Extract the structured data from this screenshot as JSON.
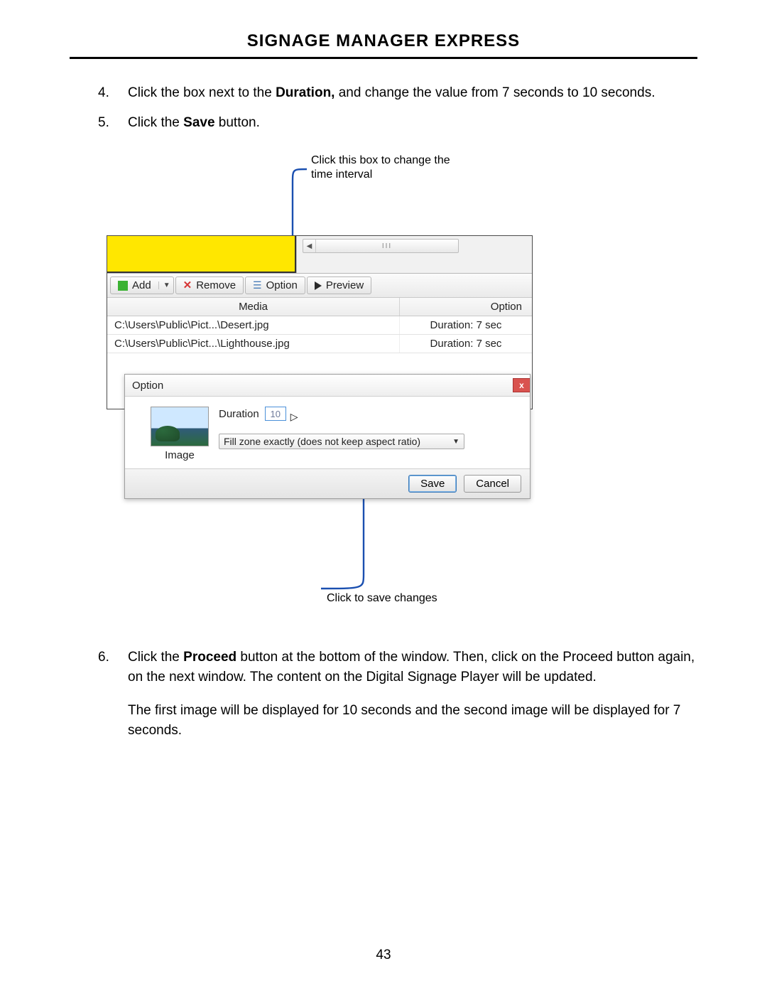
{
  "page": {
    "title": "SIGNAGE MANAGER EXPRESS",
    "number": "43"
  },
  "step4": {
    "num": "4.",
    "pre": "Click the box next to the ",
    "bold": "Duration,",
    "post": " and change the value from 7 seconds to 10 seconds."
  },
  "step5": {
    "num": "5.",
    "pre": "Click the ",
    "bold": "Save",
    "post": " button."
  },
  "callouts": {
    "top": "Click this box to change the time interval",
    "bottom": "Click to save changes"
  },
  "toolbar": {
    "add": "Add",
    "remove": "Remove",
    "option": "Option",
    "preview": "Preview"
  },
  "table": {
    "hdr_media": "Media",
    "hdr_option": "Option",
    "rows": [
      {
        "media": "C:\\Users\\Public\\Pict...\\Desert.jpg",
        "option": "Duration: 7 sec"
      },
      {
        "media": "C:\\Users\\Public\\Pict...\\Lighthouse.jpg",
        "option": "Duration: 7 sec"
      }
    ]
  },
  "dialog": {
    "title": "Option",
    "thumb_label": "Image",
    "duration_label": "Duration",
    "duration_value": "10",
    "fill_mode": "Fill zone exactly (does not keep aspect ratio)",
    "save": "Save",
    "cancel": "Cancel"
  },
  "scroll": {
    "thumb_marks": "III"
  },
  "step6": {
    "num": "6.",
    "pre": "Click the ",
    "bold": "Proceed",
    "post": " button at the bottom of the window.  Then, click on the Proceed button again, on the next window.  The content on the Digital Signage Player will be updated."
  },
  "para7": "The first image will be displayed for 10 seconds and the second image will be displayed for 7 seconds."
}
